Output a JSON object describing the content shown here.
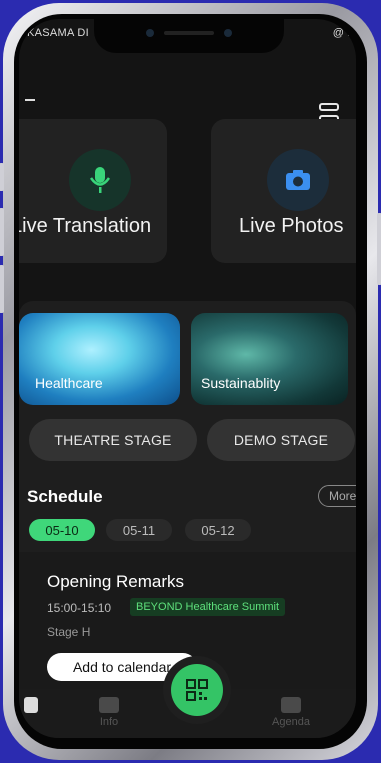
{
  "status": {
    "carrier": "KASAMA DI",
    "right_glyph": "@ ."
  },
  "features": [
    {
      "label": "Live Translation",
      "icon": "microphone-icon"
    },
    {
      "label": "Live Photos",
      "icon": "camera-icon"
    }
  ],
  "topics": [
    {
      "label": "Healthcare"
    },
    {
      "label": "Sustainablity"
    }
  ],
  "stages": [
    "THEATRE STAGE",
    "DEMO STAGE"
  ],
  "schedule": {
    "title": "Schedule",
    "more_label": "More",
    "dates": [
      "05-10",
      "05-11",
      "05-12"
    ],
    "selected_date": "05-10"
  },
  "event": {
    "title": "Opening Remarks",
    "time": "15:00-15:10",
    "tag": "BEYOND Healthcare Summit",
    "location": "Stage H",
    "add_label": "Add to calendar"
  },
  "tabs": [
    {
      "label": "Info",
      "icon": "chat-icon"
    },
    {
      "label": "Agenda",
      "icon": "calendar-icon"
    }
  ],
  "colors": {
    "accent": "#34c466",
    "screen_bg": "#141414",
    "frame_bg": "#2b2bb0"
  }
}
